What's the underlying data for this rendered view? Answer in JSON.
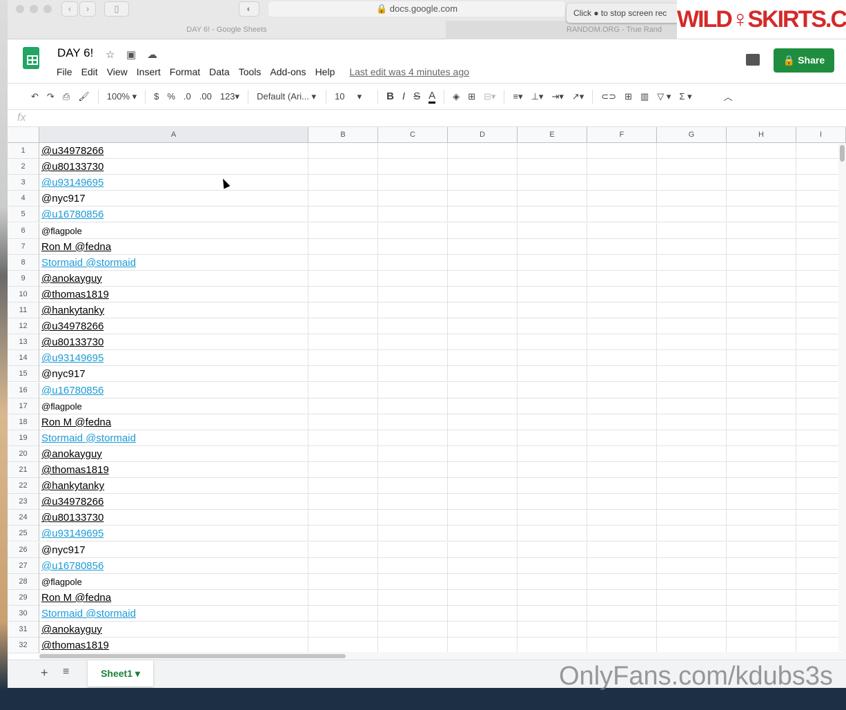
{
  "browser": {
    "url": "docs.google.com",
    "tabs": [
      "DAY 6! - Google Sheets",
      "RANDOM.ORG - True Rand"
    ],
    "tooltip": "Click ● to stop screen rec"
  },
  "watermark_logo": "WILDSKIRTS.COM",
  "watermark_text": "OnlyFans.com/kdubs3s",
  "doc": {
    "title": "DAY 6!",
    "menu": [
      "File",
      "Edit",
      "View",
      "Insert",
      "Format",
      "Data",
      "Tools",
      "Add-ons",
      "Help"
    ],
    "last_edit": "Last edit was 4 minutes ago",
    "share": "Share"
  },
  "toolbar": {
    "zoom": "100%",
    "currency": "$",
    "percent": "%",
    "dec_less": ".0",
    "dec_more": ".00",
    "more_formats": "123",
    "font": "Default (Ari...",
    "font_size": "10",
    "bold": "B",
    "italic": "I",
    "strike": "S",
    "text_color": "A"
  },
  "formula_bar": {
    "fx": "fx",
    "value": ""
  },
  "columns": [
    "A",
    "B",
    "C",
    "D",
    "E",
    "F",
    "G",
    "H",
    "I"
  ],
  "rows": [
    {
      "n": "1",
      "a": "@u34978266",
      "style": "u"
    },
    {
      "n": "2",
      "a": "@u80133730",
      "style": "u"
    },
    {
      "n": "3",
      "a": "@u93149695",
      "style": "link"
    },
    {
      "n": "4",
      "a": "@nyc917",
      "style": ""
    },
    {
      "n": "5",
      "a": "@u16780856",
      "style": "link"
    },
    {
      "n": "6",
      "a": "@flagpole",
      "style": "small"
    },
    {
      "n": "7",
      "a": "Ron M @fedna",
      "style": "u"
    },
    {
      "n": "8",
      "a": "Stormaid @stormaid",
      "style": "link"
    },
    {
      "n": "9",
      "a": "@anokayguy",
      "style": "u"
    },
    {
      "n": "10",
      "a": "@thomas1819",
      "style": "u"
    },
    {
      "n": "11",
      "a": "@hankytanky",
      "style": "u"
    },
    {
      "n": "12",
      "a": "@u34978266",
      "style": "u"
    },
    {
      "n": "13",
      "a": "@u80133730",
      "style": "u"
    },
    {
      "n": "14",
      "a": "@u93149695",
      "style": "link"
    },
    {
      "n": "15",
      "a": "@nyc917",
      "style": ""
    },
    {
      "n": "16",
      "a": "@u16780856",
      "style": "link"
    },
    {
      "n": "17",
      "a": "@flagpole",
      "style": "small"
    },
    {
      "n": "18",
      "a": "Ron M @fedna",
      "style": "u"
    },
    {
      "n": "19",
      "a": "Stormaid @stormaid",
      "style": "link"
    },
    {
      "n": "20",
      "a": "@anokayguy",
      "style": "u"
    },
    {
      "n": "21",
      "a": "@thomas1819",
      "style": "u"
    },
    {
      "n": "22",
      "a": "@hankytanky",
      "style": "u"
    },
    {
      "n": "23",
      "a": "@u34978266",
      "style": "u"
    },
    {
      "n": "24",
      "a": "@u80133730",
      "style": "u"
    },
    {
      "n": "25",
      "a": "@u93149695",
      "style": "link"
    },
    {
      "n": "26",
      "a": "@nyc917",
      "style": ""
    },
    {
      "n": "27",
      "a": "@u16780856",
      "style": "link"
    },
    {
      "n": "28",
      "a": "@flagpole",
      "style": "small"
    },
    {
      "n": "29",
      "a": "Ron M @fedna",
      "style": "u"
    },
    {
      "n": "30",
      "a": "Stormaid @stormaid",
      "style": "link"
    },
    {
      "n": "31",
      "a": "@anokayguy",
      "style": "u"
    },
    {
      "n": "32",
      "a": "@thomas1819",
      "style": "u"
    }
  ],
  "sheets": {
    "add": "+",
    "list": "≡",
    "active": "Sheet1 ▾"
  }
}
